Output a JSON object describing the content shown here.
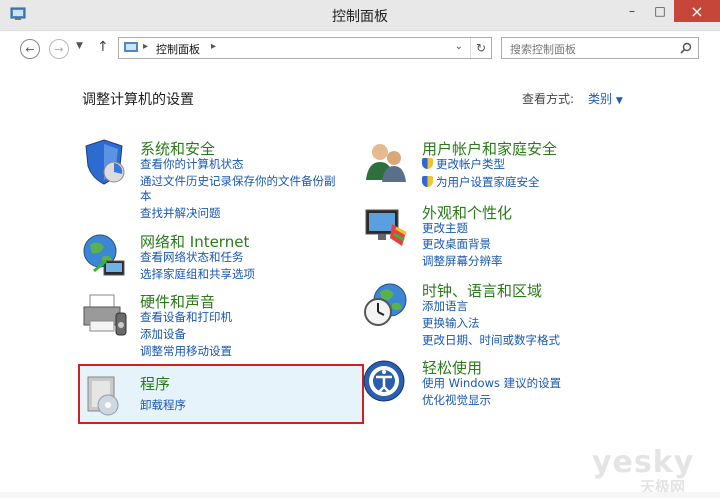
{
  "window": {
    "title": "控制面板",
    "minimize": "–",
    "maximize": "□",
    "close": "×"
  },
  "address": {
    "breadcrumb": "控制面板",
    "search_placeholder": "搜索控制面板"
  },
  "heading": "调整计算机的设置",
  "view_by": {
    "label": "查看方式:",
    "value": "类别"
  },
  "categories": {
    "system_security": {
      "title": "系统和安全",
      "links": [
        "查看你的计算机状态",
        "通过文件历史记录保存你的文件备份副",
        "本",
        "查找并解决问题"
      ]
    },
    "network": {
      "title": "网络和 Internet",
      "links": [
        "查看网络状态和任务",
        "选择家庭组和共享选项"
      ]
    },
    "hardware": {
      "title": "硬件和声音",
      "links": [
        "查看设备和打印机",
        "添加设备",
        "调整常用移动设置"
      ]
    },
    "programs": {
      "title": "程序",
      "links": [
        "卸载程序"
      ]
    },
    "user_accounts": {
      "title": "用户帐户和家庭安全",
      "links": [
        "更改帐户类型",
        "为用户设置家庭安全"
      ]
    },
    "appearance": {
      "title": "外观和个性化",
      "links": [
        "更改主题",
        "更改桌面背景",
        "调整屏幕分辨率"
      ]
    },
    "clock": {
      "title": "时钟、语言和区域",
      "links": [
        "添加语言",
        "更换输入法",
        "更改日期、时间或数字格式"
      ]
    },
    "ease": {
      "title": "轻松使用",
      "links": [
        "使用 Windows 建议的设置",
        "优化视觉显示"
      ]
    }
  },
  "watermark": {
    "main": "yesky",
    "sub": "天极网"
  },
  "colors": {
    "title_green": "#2b7a1a",
    "link_blue": "#1a58b0",
    "highlight_border": "#cc2222"
  }
}
